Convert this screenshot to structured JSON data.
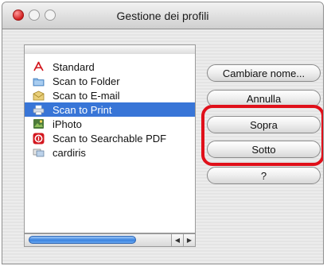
{
  "window": {
    "title": "Gestione dei profili"
  },
  "profiles": [
    {
      "label": "Standard",
      "icon": "adobe-pdf-icon",
      "selected": false
    },
    {
      "label": "Scan to Folder",
      "icon": "folder-icon",
      "selected": false
    },
    {
      "label": "Scan to E-mail",
      "icon": "mail-icon",
      "selected": false
    },
    {
      "label": "Scan to Print",
      "icon": "printer-icon",
      "selected": true
    },
    {
      "label": "iPhoto",
      "icon": "iphoto-icon",
      "selected": false
    },
    {
      "label": "Scan to Searchable PDF",
      "icon": "searchable-pdf-icon",
      "selected": false
    },
    {
      "label": "cardiris",
      "icon": "cardiris-icon",
      "selected": false
    }
  ],
  "buttons": {
    "rename": "Cambiare nome...",
    "cancel": "Annulla",
    "up": "Sopra",
    "down": "Sotto",
    "help": "?"
  },
  "colors": {
    "selection": "#3875d7",
    "highlight_ring": "#e0101a"
  }
}
